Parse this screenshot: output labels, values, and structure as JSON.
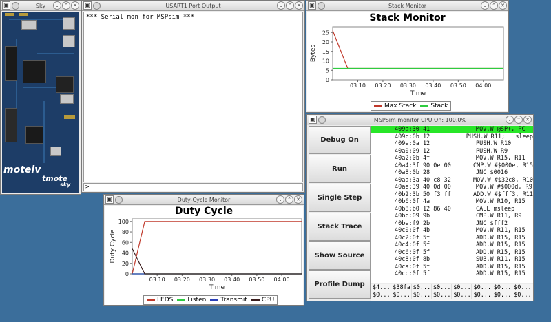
{
  "sky": {
    "title": "Sky",
    "brand_moteiv": "moteiv",
    "brand_tmote": "tmote",
    "brand_sky": "sky"
  },
  "usart": {
    "title": "USART1 Port Output",
    "output": "*** Serial mon for MSPsim ***",
    "input_prompt": ">"
  },
  "stack_monitor": {
    "window_title": "Stack Monitor",
    "chart_title": "Stack Monitor",
    "ylabel": "Bytes",
    "xlabel": "Time",
    "yticks": [
      "25",
      "20",
      "15",
      "10",
      "5",
      "0"
    ],
    "xticks": [
      "03:10",
      "03:20",
      "03:30",
      "03:40",
      "03:50",
      "04:00"
    ],
    "legend": [
      "Max Stack",
      "Stack"
    ]
  },
  "duty_monitor": {
    "window_title": "Duty-Cycle Monitor",
    "chart_title": "Duty Cycle",
    "ylabel": "Duty Cycle",
    "xlabel": "Time",
    "yticks": [
      "100",
      "80",
      "60",
      "40",
      "20",
      "0"
    ],
    "xticks": [
      "03:10",
      "03:20",
      "03:30",
      "03:40",
      "03:50",
      "04:00"
    ],
    "legend": [
      "LEDS",
      "Listen",
      "Transmit",
      "CPU"
    ]
  },
  "chart_data": [
    {
      "type": "line",
      "title": "Stack Monitor",
      "xlabel": "Time",
      "ylabel": "Bytes",
      "ylim": [
        0,
        28
      ],
      "x_range": [
        "03:00",
        "04:08"
      ],
      "grid": false,
      "legend_position": "bottom",
      "series": [
        {
          "name": "Max Stack",
          "color": "#c0392b",
          "points": [
            [
              "03:00",
              26
            ],
            [
              "03:06",
              6
            ],
            [
              "04:08",
              6
            ]
          ]
        },
        {
          "name": "Stack",
          "color": "#2ecc40",
          "points": [
            [
              "03:00",
              6
            ],
            [
              "03:06",
              6
            ],
            [
              "04:08",
              6
            ]
          ]
        }
      ]
    },
    {
      "type": "line",
      "title": "Duty Cycle",
      "xlabel": "Time",
      "ylabel": "Duty Cycle",
      "ylim": [
        0,
        105
      ],
      "x_range": [
        "03:00",
        "04:08"
      ],
      "grid": false,
      "legend_position": "bottom",
      "series": [
        {
          "name": "LEDS",
          "color": "#c0392b",
          "points": [
            [
              "03:00",
              0
            ],
            [
              "03:05",
              100
            ],
            [
              "04:08",
              100
            ]
          ]
        },
        {
          "name": "Listen",
          "color": "#2ecc40",
          "points": [
            [
              "03:00",
              0
            ],
            [
              "04:08",
              0
            ]
          ]
        },
        {
          "name": "Transmit",
          "color": "#2b3fb8",
          "points": [
            [
              "03:00",
              0
            ],
            [
              "04:08",
              0
            ]
          ]
        },
        {
          "name": "CPU",
          "color": "#3b1d1d",
          "points": [
            [
              "03:00",
              48
            ],
            [
              "03:05",
              0
            ],
            [
              "04:08",
              0
            ]
          ]
        }
      ]
    }
  ],
  "msp_monitor": {
    "title": "MSPSim monitor  CPU On: 100.0%",
    "buttons": [
      "Debug On",
      "Run",
      "Single Step",
      "Stack Trace",
      "Show Source",
      "Profile Dump"
    ],
    "disasm": [
      {
        "addr": "409a:30 41",
        "instr": "MOV.W @SP+, PC"
      },
      {
        "addr": "409c:0b 12",
        "instr": "PUSH.W R11;   sleep"
      },
      {
        "addr": "409e:0a 12",
        "instr": "PUSH.W R10"
      },
      {
        "addr": "40a0:09 12",
        "instr": "PUSH.W R9"
      },
      {
        "addr": "40a2:0b 4f",
        "instr": "MOV.W R15, R11"
      },
      {
        "addr": "40a4:3f 90 0e 00",
        "instr": "CMP.W #$000e, R15"
      },
      {
        "addr": "40a8:0b 28",
        "instr": "JNC $0016"
      },
      {
        "addr": "40aa:3a 40 c8 32",
        "instr": "MOV.W #$32c8, R10"
      },
      {
        "addr": "40ae:39 40 0d 00",
        "instr": "MOV.W #$000d, R9"
      },
      {
        "addr": "40b2:3b 50 f3 ff",
        "instr": "ADD.W #$fff3, R11"
      },
      {
        "addr": "40b6:0f 4a",
        "instr": "MOV.W R10, R15"
      },
      {
        "addr": "40b8:b0 12 86 40",
        "instr": "CALL msleep"
      },
      {
        "addr": "40bc:09 9b",
        "instr": "CMP.W R11, R9"
      },
      {
        "addr": "40be:f9 2b",
        "instr": "JNC $fff2"
      },
      {
        "addr": "40c0:0f 4b",
        "instr": "MOV.W R11, R15"
      },
      {
        "addr": "40c2:0f 5f",
        "instr": "ADD.W R15, R15"
      },
      {
        "addr": "40c4:0f 5f",
        "instr": "ADD.W R15, R15"
      },
      {
        "addr": "40c6:0f 5f",
        "instr": "ADD.W R15, R15"
      },
      {
        "addr": "40c8:0f 8b",
        "instr": "SUB.W R11, R15"
      },
      {
        "addr": "40ca:0f 5f",
        "instr": "ADD.W R15, R15"
      },
      {
        "addr": "40cc:0f 5f",
        "instr": "ADD.W R15, R15"
      }
    ],
    "registers_row1": [
      "$4...",
      "$38fa",
      "$0...",
      "$0...",
      "$0...",
      "$0...",
      "$0...",
      "$0..."
    ],
    "registers_row2": [
      "$0...",
      "$0...",
      "$0...",
      "$0...",
      "$0...",
      "$0...",
      "$0...",
      "$0..."
    ]
  }
}
